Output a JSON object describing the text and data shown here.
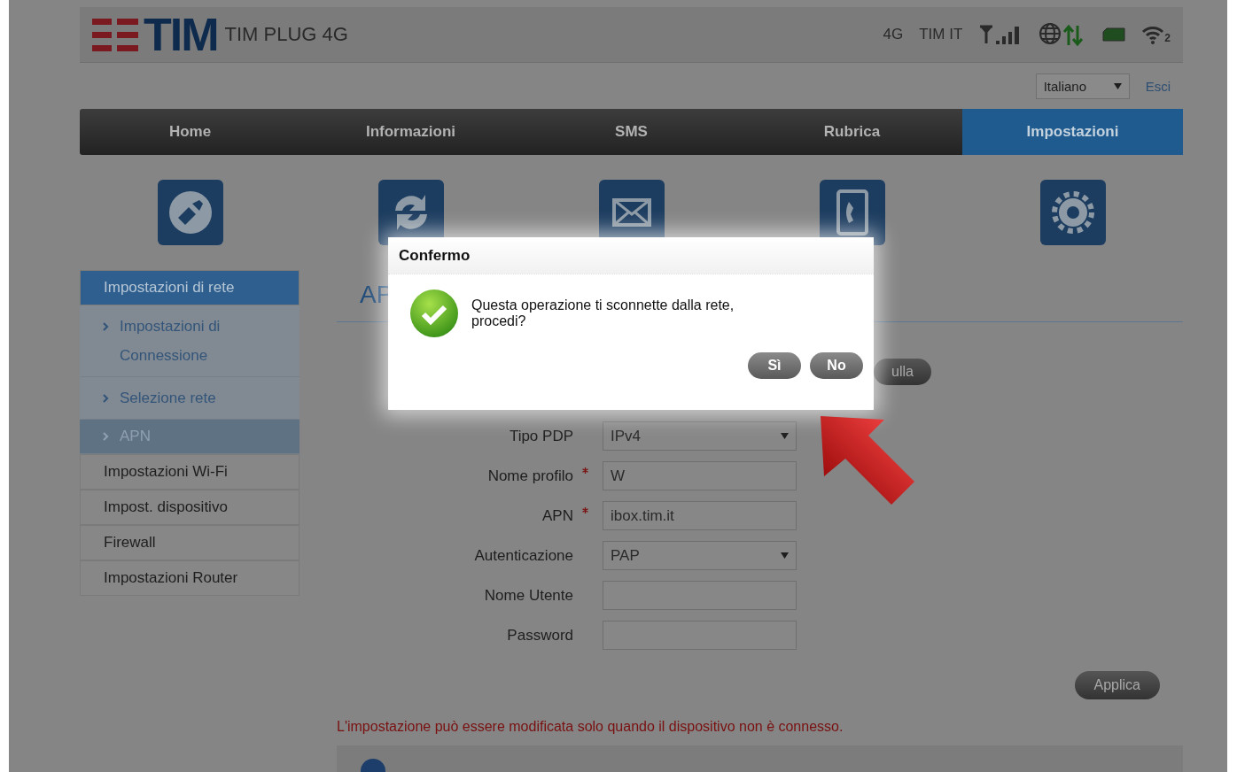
{
  "header": {
    "logo": "TIM",
    "product": "TIM PLUG 4G",
    "network_type": "4G",
    "operator": "TIM IT",
    "wifi_count": "2"
  },
  "language": {
    "value": "Italiano"
  },
  "logout": "Esci",
  "tabs": [
    {
      "label": "Home",
      "selected": false
    },
    {
      "label": "Informazioni",
      "selected": false
    },
    {
      "label": "SMS",
      "selected": false
    },
    {
      "label": "Rubrica",
      "selected": false
    },
    {
      "label": "Impostazioni",
      "selected": true
    }
  ],
  "sidebar": {
    "items": [
      {
        "label": "Impostazioni di rete",
        "expanded": true,
        "children": [
          {
            "label": "Impostazioni di Connessione",
            "selected": false
          },
          {
            "label": "Selezione rete",
            "selected": false
          },
          {
            "label": "APN",
            "selected": true
          }
        ]
      },
      {
        "label": "Impostazioni Wi-Fi",
        "expanded": false
      },
      {
        "label": "Impost. dispositivo",
        "expanded": false
      },
      {
        "label": "Firewall",
        "expanded": false
      },
      {
        "label": "Impostazioni Router",
        "expanded": false
      }
    ]
  },
  "content": {
    "heading": "AP",
    "cancel_button": "ulla",
    "fields": [
      {
        "label": "Tipo PDP",
        "required": false,
        "kind": "select",
        "value": "IPv4"
      },
      {
        "label": "Nome profilo",
        "required": true,
        "kind": "text",
        "value": "W"
      },
      {
        "label": "APN",
        "required": true,
        "kind": "text",
        "value": "ibox.tim.it"
      },
      {
        "label": "Autenticazione",
        "required": false,
        "kind": "select",
        "value": "PAP"
      },
      {
        "label": "Nome Utente",
        "required": false,
        "kind": "text"
      },
      {
        "label": "Password",
        "required": false,
        "kind": "text"
      }
    ],
    "apply_button": "Applica",
    "note": "L'impostazione può essere modificata solo quando il dispositivo non è connesso."
  },
  "dialog": {
    "title": "Confermo",
    "message": "Questa operazione ti sconnette dalla rete, procedi?",
    "buttons": [
      "Sì",
      "No"
    ]
  }
}
